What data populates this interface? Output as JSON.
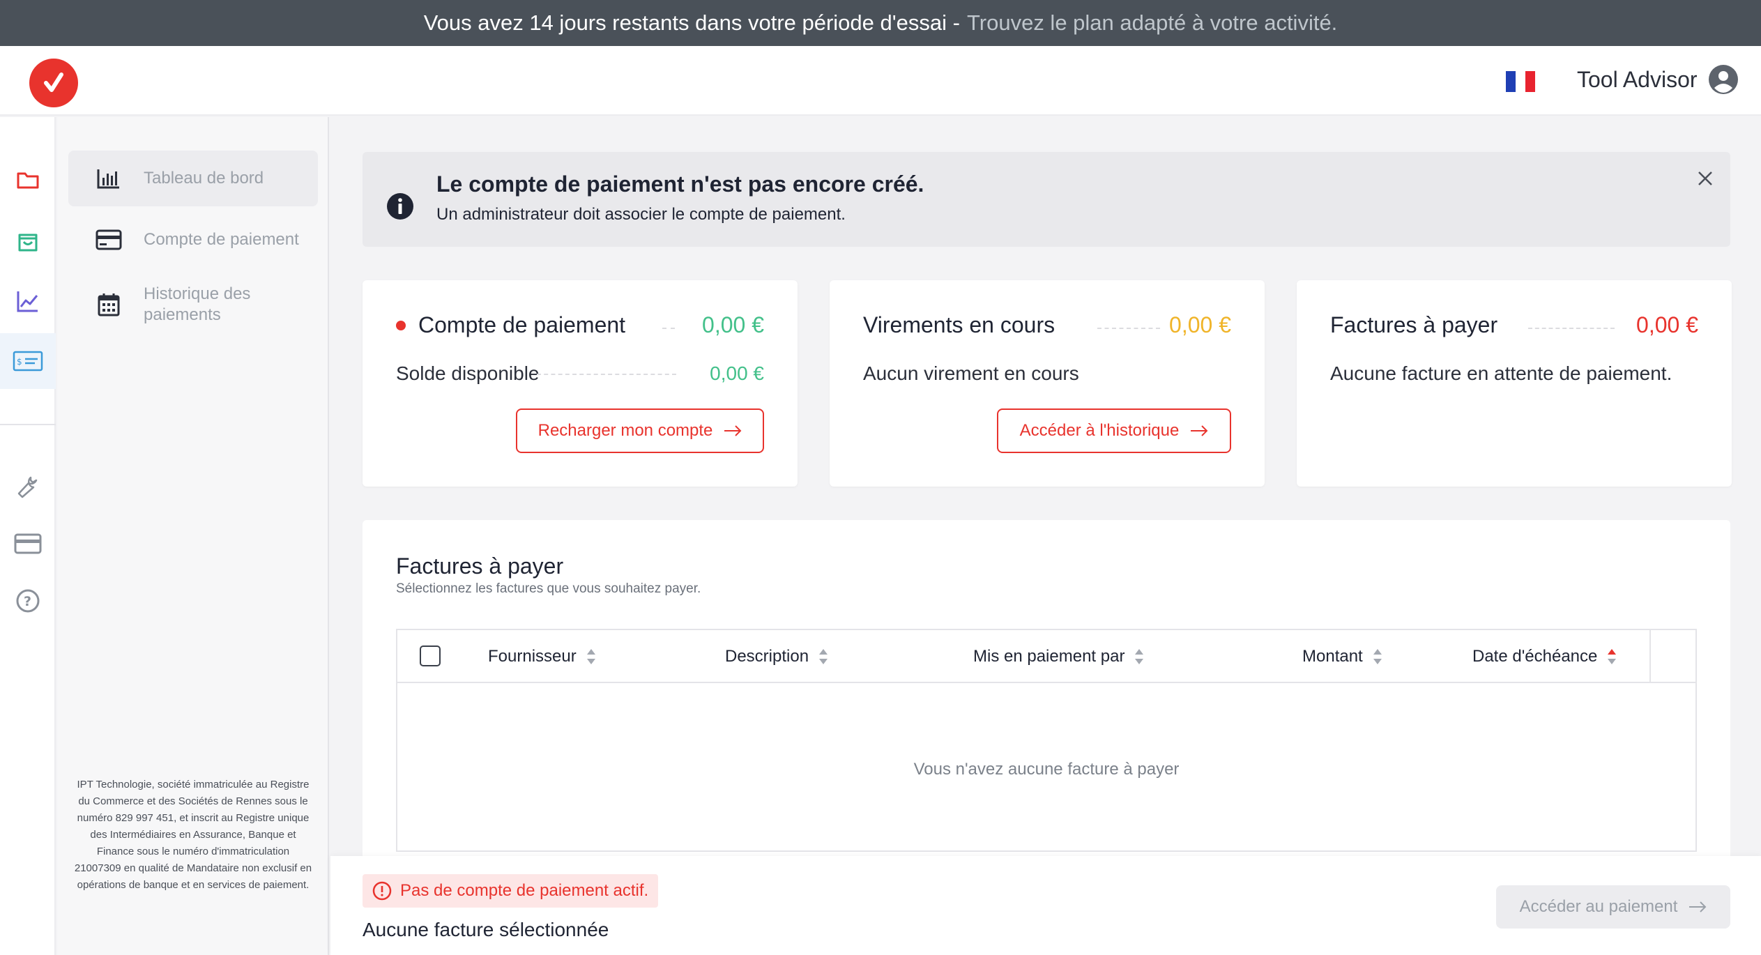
{
  "trial_banner": {
    "text": "Vous avez 14 jours restants dans votre période d'essai -",
    "link": "Trouvez le plan adapté à votre activité."
  },
  "header": {
    "user_name": "Tool Advisor",
    "flag_colors": [
      "#1f3fb4",
      "#ffffff",
      "#e8232f"
    ]
  },
  "rail": {
    "items": [
      {
        "icon": "folder-icon",
        "color": "#e8332d"
      },
      {
        "icon": "shopping-bag-icon",
        "color": "#2fb58a"
      },
      {
        "icon": "chart-line-icon",
        "color": "#6b5fd6"
      },
      {
        "icon": "payment-card-icon",
        "color": "#3b9ad9",
        "active": true
      },
      {
        "icon": "wrench-icon",
        "color": "#8a9099"
      },
      {
        "icon": "credit-card-icon",
        "color": "#8a9099"
      },
      {
        "icon": "help-icon",
        "color": "#8a9099"
      }
    ]
  },
  "subnav": {
    "items": [
      {
        "label": "Tableau de bord",
        "icon": "bar-chart-icon",
        "active": true
      },
      {
        "label": "Compte de paiement",
        "icon": "card-icon"
      },
      {
        "label": "Historique des paiements",
        "icon": "calendar-icon"
      }
    ],
    "legal": "IPT Technologie, société immatriculée au Registre du Commerce et des Sociétés de Rennes sous le numéro 829 997 451, et inscrit au Registre unique des Intermédiaires en Assurance, Banque et Finance sous le numéro d'immatriculation 21007309 en qualité de Mandataire non exclusif en opérations de banque et en services de paiement."
  },
  "info_banner": {
    "title": "Le compte de paiement n'est pas encore créé.",
    "text": "Un administrateur doit associer le compte de paiement."
  },
  "cards": [
    {
      "title": "Compte de paiement",
      "amount": "0,00 €",
      "amount_color": "#43c08a",
      "sub_label": "Solde disponible",
      "sub_amount": "0,00 €",
      "button": "Recharger mon compte"
    },
    {
      "title": "Virements en cours",
      "amount": "0,00 €",
      "amount_color": "#f0b429",
      "sub_label": "Aucun virement en cours",
      "button": "Accéder à l'historique"
    },
    {
      "title": "Factures à payer",
      "amount": "0,00 €",
      "amount_color": "#e8332d",
      "sub_label": "Aucune facture en attente de paiement."
    }
  ],
  "invoices": {
    "title": "Factures à payer",
    "subtitle": "Sélectionnez les factures que vous souhaitez payer.",
    "columns": [
      "Fournisseur",
      "Description",
      "Mis en paiement par",
      "Montant",
      "Date d'échéance"
    ],
    "empty": "Vous n'avez aucune facture à payer"
  },
  "footer": {
    "alert": "Pas de compte de paiement actif.",
    "selection": "Aucune facture sélectionnée",
    "pay_button": "Accéder au paiement"
  }
}
